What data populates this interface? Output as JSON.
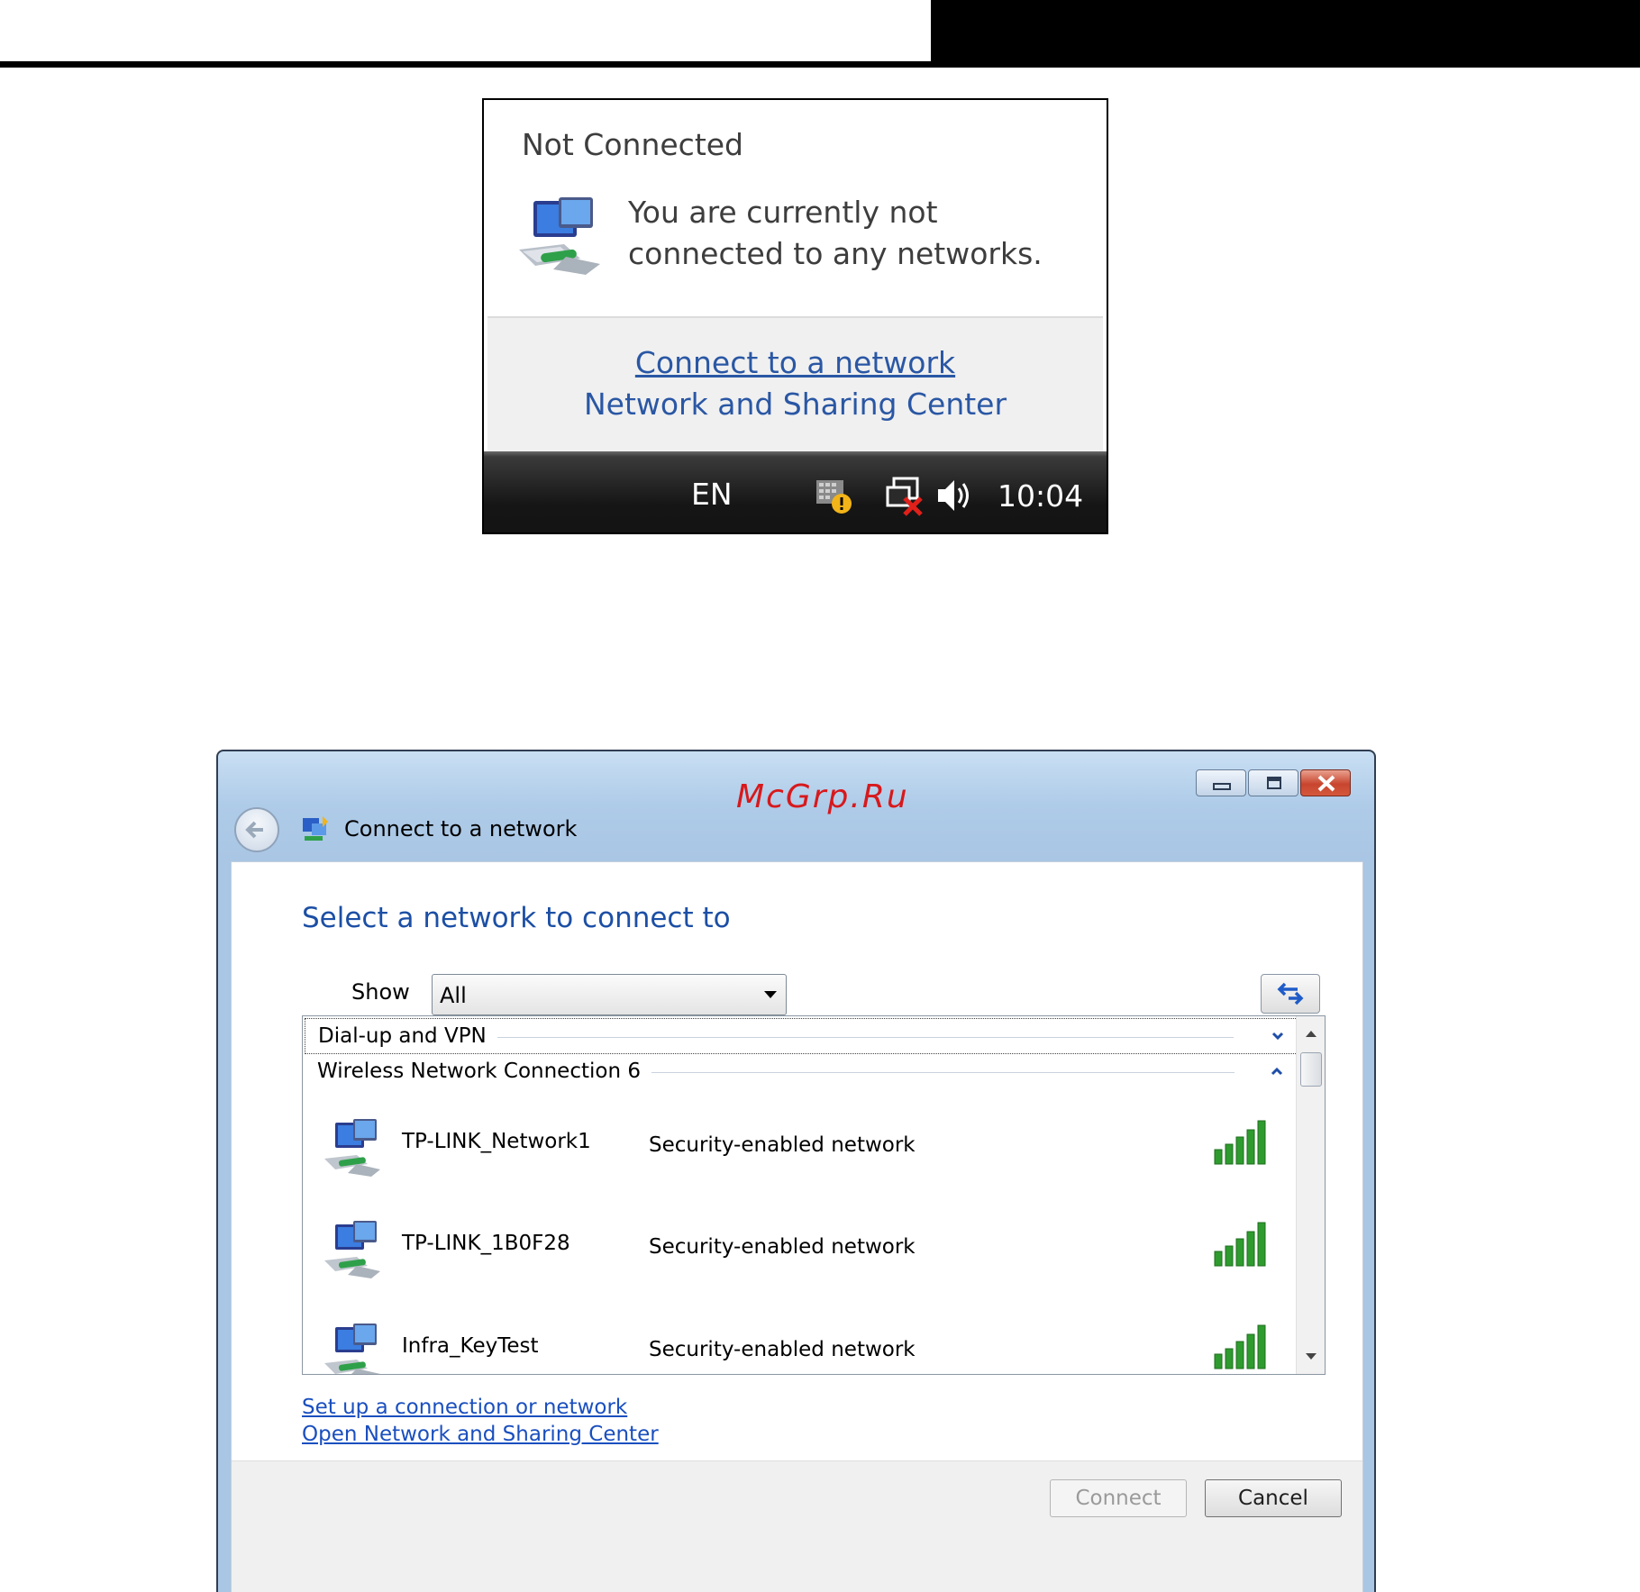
{
  "popup": {
    "title": "Not Connected",
    "message_line1": "You are currently not",
    "message_line2": "connected to any networks.",
    "link_connect": "Connect to a network",
    "link_center": "Network and Sharing Center",
    "taskbar": {
      "language": "EN",
      "clock": "10:04"
    }
  },
  "dialog": {
    "watermark": "McGrp.Ru",
    "title": "Connect to a network",
    "heading": "Select a network to connect to",
    "show_label": "Show",
    "show_value": "All",
    "groups": [
      {
        "label": "Dial-up and VPN",
        "state": "collapsed"
      },
      {
        "label": "Wireless Network Connection 6",
        "state": "expanded"
      }
    ],
    "networks": [
      {
        "name": "TP-LINK_Network1",
        "security": "Security-enabled network",
        "signal_bars": 5
      },
      {
        "name": "TP-LINK_1B0F28",
        "security": "Security-enabled network",
        "signal_bars": 5
      },
      {
        "name": "Infra_KeyTest",
        "security": "Security-enabled network",
        "signal_bars": 5
      }
    ],
    "link_setup": "Set up a connection or network",
    "link_open_center": "Open Network and Sharing Center",
    "btn_connect": "Connect",
    "btn_cancel": "Cancel"
  },
  "colors": {
    "link": "#1a4fbf",
    "heading": "#1c4fa5",
    "signal": "#2e9b2e",
    "watermark": "#d7191c"
  }
}
